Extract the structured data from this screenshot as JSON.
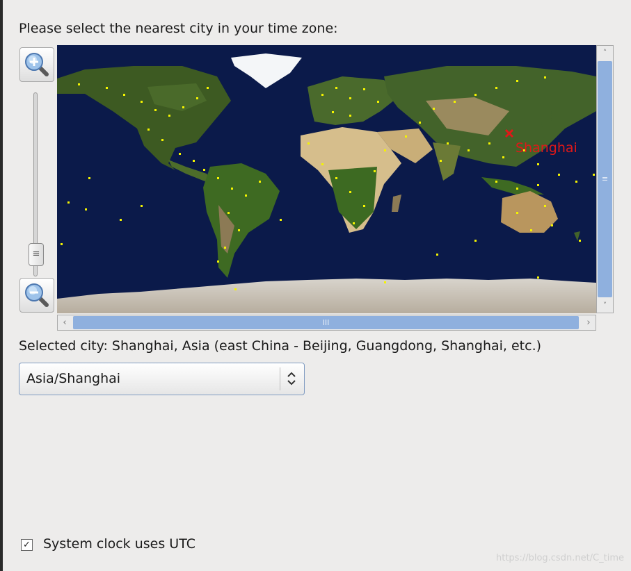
{
  "prompt": "Please select the nearest city in your time zone:",
  "map": {
    "highlighted_city": "Shanghai",
    "marker_color": "#e01818",
    "city_dot_color": "#f4f400"
  },
  "zoom": {
    "in_icon": "zoom-in-icon",
    "out_icon": "zoom-out-icon",
    "slider_grip": "≡"
  },
  "scrollbars": {
    "vertical_grip": "≡",
    "horizontal_grip": "III",
    "left_arrow": "‹",
    "right_arrow": "›",
    "up_arrow": "˄",
    "down_arrow": "˅"
  },
  "selected_city": "Selected city: Shanghai, Asia (east China - Beijing, Guangdong, Shanghai, etc.)",
  "timezone_select": {
    "value": "Asia/Shanghai"
  },
  "utc_checkbox": {
    "label": "System clock uses UTC",
    "checked": true,
    "check_mark": "✓"
  },
  "watermark": "https://blog.csdn.net/C_time"
}
